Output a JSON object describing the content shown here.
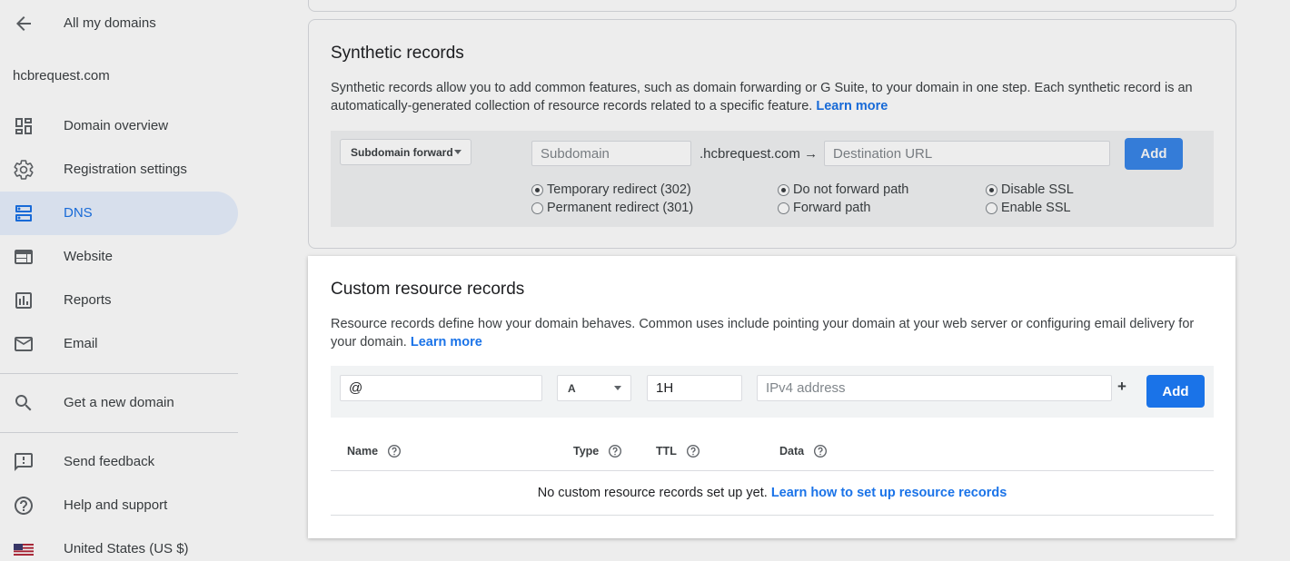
{
  "sidebar": {
    "back_label": "All my domains",
    "domain": "hcbrequest.com",
    "items": [
      {
        "label": "Domain overview",
        "icon": "dashboard-icon",
        "active": false
      },
      {
        "label": "Registration settings",
        "icon": "gear-icon",
        "active": false
      },
      {
        "label": "DNS",
        "icon": "dns-icon",
        "active": true
      },
      {
        "label": "Website",
        "icon": "web-icon",
        "active": false
      },
      {
        "label": "Reports",
        "icon": "bar-chart-icon",
        "active": false
      },
      {
        "label": "Email",
        "icon": "mail-icon",
        "active": false
      }
    ],
    "get_domain": "Get a new domain",
    "feedback": "Send feedback",
    "help": "Help and support",
    "locale": "United States (US $)"
  },
  "synthetic": {
    "title": "Synthetic records",
    "description": "Synthetic records allow you to add common features, such as domain forwarding or G Suite, to your domain in one step. Each synthetic record is an automatically-generated collection of resource records related to a specific feature.",
    "learn_more": "Learn more",
    "type_select": "Subdomain forward",
    "subdomain_placeholder": "Subdomain",
    "suffix": ".hcbrequest.com",
    "arrow": "→",
    "destination_placeholder": "Destination URL",
    "add_label": "Add",
    "redirect_options": [
      "Temporary redirect (302)",
      "Permanent redirect (301)"
    ],
    "path_options": [
      "Do not forward path",
      "Forward path"
    ],
    "ssl_options": [
      "Disable SSL",
      "Enable SSL"
    ]
  },
  "custom": {
    "title": "Custom resource records",
    "description": "Resource records define how your domain behaves. Common uses include pointing your domain at your web server or configuring email delivery for your domain.",
    "learn_more": "Learn more",
    "name_value": "@",
    "type_value": "A",
    "ttl_value": "1H",
    "data_placeholder": "IPv4 address",
    "plus": "+",
    "add_label": "Add",
    "columns": [
      "Name",
      "Type",
      "TTL",
      "Data"
    ],
    "empty_text": "No custom resource records set up yet.",
    "empty_link": "Learn how to set up resource records"
  },
  "colors": {
    "accent": "#1a73e8",
    "active_bg": "#e8f0fe",
    "panel_bg": "#f1f3f4"
  }
}
